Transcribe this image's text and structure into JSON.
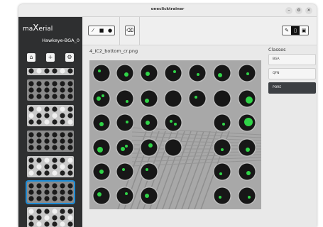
{
  "window": {
    "title": "oneclicktrainer",
    "controls": [
      "–",
      "⚙",
      "✕"
    ]
  },
  "sidebar": {
    "logo_prefix": "ma",
    "logo_big": "X",
    "logo_suffix": "erial",
    "project": "Hawkeye-BGA_0",
    "buttons": [
      "home-icon",
      "plus-icon",
      "gear-icon"
    ],
    "thumbnails": [
      {
        "selected": false
      },
      {
        "selected": false
      },
      {
        "selected": false
      },
      {
        "selected": false
      },
      {
        "selected": false
      },
      {
        "selected": true
      },
      {
        "selected": false
      }
    ]
  },
  "toolbar": {
    "tools_left": [
      "wand-icon",
      "rectangle-icon",
      "circle-icon"
    ],
    "eraser": "eraser-icon",
    "tools_right": [
      "annotate-icon",
      "clipboard-icon",
      "save-icon"
    ]
  },
  "main": {
    "filename": "4_IC2_bottom_cr.png"
  },
  "classes": {
    "title": "Classes",
    "items": [
      {
        "label": "BGA",
        "active": false
      },
      {
        "label": "QFN",
        "active": false
      },
      {
        "label": "PORE",
        "active": true
      }
    ]
  },
  "colors": {
    "sidebar": "#2e2f30",
    "pore": "#2fd447",
    "selection": "#1f8dd6",
    "active_class": "#3c3f43"
  }
}
